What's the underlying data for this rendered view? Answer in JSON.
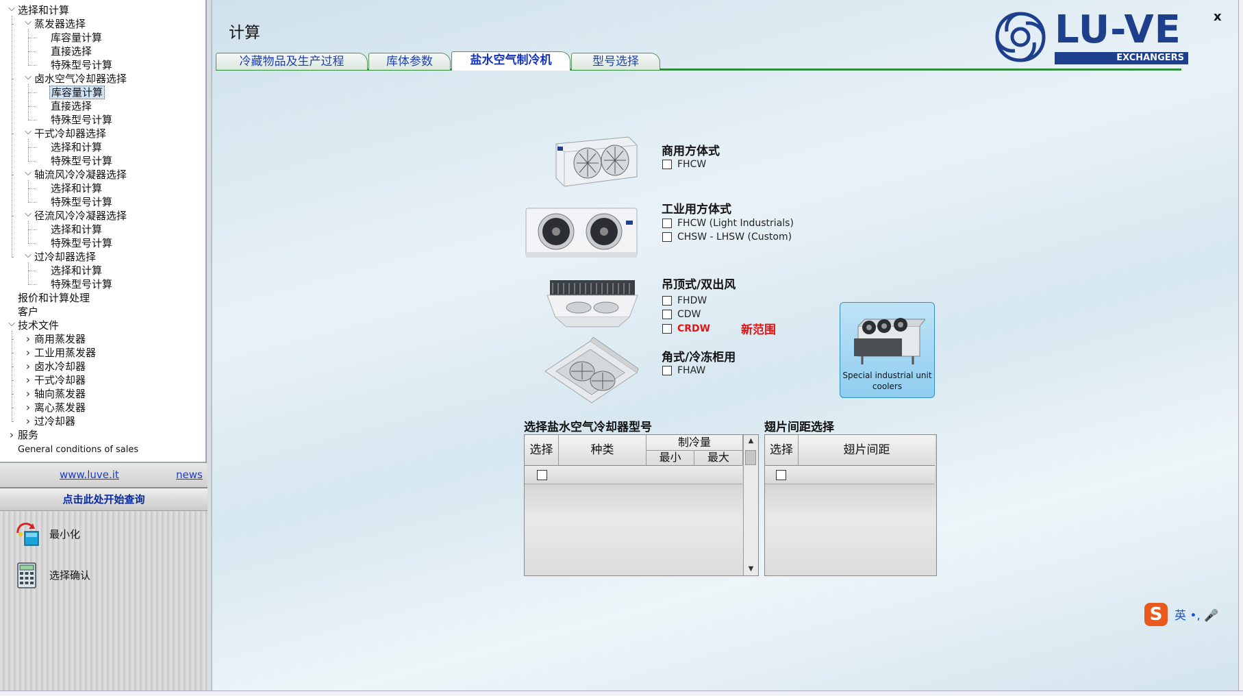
{
  "tree": {
    "items": [
      {
        "label": "选择和计算",
        "level": 0,
        "expander": "down"
      },
      {
        "label": "蒸发器选择",
        "level": 1,
        "expander": "down"
      },
      {
        "label": "库容量计算",
        "level": 2
      },
      {
        "label": "直接选择",
        "level": 2
      },
      {
        "label": "特殊型号计算",
        "level": 2
      },
      {
        "label": "卤水空气冷却器选择",
        "level": 1,
        "expander": "down"
      },
      {
        "label": "库容量计算",
        "level": 2,
        "selected": true
      },
      {
        "label": "直接选择",
        "level": 2
      },
      {
        "label": "特殊型号计算",
        "level": 2
      },
      {
        "label": "干式冷却器选择",
        "level": 1,
        "expander": "down"
      },
      {
        "label": "选择和计算",
        "level": 2
      },
      {
        "label": "特殊型号计算",
        "level": 2
      },
      {
        "label": "轴流风冷冷凝器选择",
        "level": 1,
        "expander": "down"
      },
      {
        "label": "选择和计算",
        "level": 2
      },
      {
        "label": "特殊型号计算",
        "level": 2
      },
      {
        "label": "径流风冷冷凝器选择",
        "level": 1,
        "expander": "down"
      },
      {
        "label": "选择和计算",
        "level": 2
      },
      {
        "label": "特殊型号计算",
        "level": 2
      },
      {
        "label": "过冷却器选择",
        "level": 1,
        "expander": "down"
      },
      {
        "label": "选择和计算",
        "level": 2
      },
      {
        "label": "特殊型号计算",
        "level": 2
      },
      {
        "label": "报价和计算处理",
        "level": 0
      },
      {
        "label": "客户",
        "level": 0
      },
      {
        "label": "技术文件",
        "level": 0,
        "expander": "down"
      },
      {
        "label": "商用蒸发器",
        "level": 1,
        "expander": "right"
      },
      {
        "label": "工业用蒸发器",
        "level": 1,
        "expander": "right"
      },
      {
        "label": "卤水冷却器",
        "level": 1,
        "expander": "right"
      },
      {
        "label": "干式冷却器",
        "level": 1,
        "expander": "right"
      },
      {
        "label": "轴向蒸发器",
        "level": 1,
        "expander": "right"
      },
      {
        "label": "离心蒸发器",
        "level": 1,
        "expander": "right"
      },
      {
        "label": "过冷却器",
        "level": 1,
        "expander": "right"
      },
      {
        "label": "服务",
        "level": 0,
        "expander": "right"
      },
      {
        "label": "General conditions of sales",
        "level": 0
      }
    ]
  },
  "links": {
    "site": "www.luve.it",
    "news": "news"
  },
  "start_query": "点击此处开始查询",
  "actions": {
    "minimize": "最小化",
    "confirm": "选择确认"
  },
  "main": {
    "title": "计算",
    "close": "x",
    "logo": {
      "word": "LU-VE",
      "band": "EXCHANGERS",
      "accent": "#1d3f8c"
    },
    "tabs": [
      "冷藏物品及生产过程",
      "库体参数",
      "盐水空气制冷机",
      "型号选择"
    ],
    "active_tab": 2
  },
  "groups": {
    "commercial": {
      "title": "商用方体式",
      "options": [
        "FHCW"
      ]
    },
    "industrial": {
      "title": "工业用方体式",
      "options": [
        "FHCW (Light Industrials)",
        "CHSW - LHSW (Custom)"
      ]
    },
    "ceiling": {
      "title": "吊顶式/双出风",
      "options": [
        "FHDW",
        "CDW",
        "CRDW"
      ],
      "new_range": "新范围"
    },
    "corner": {
      "title": "角式/冷冻柜用",
      "options": [
        "FHAW"
      ]
    }
  },
  "special": {
    "label": "Special industrial unit coolers"
  },
  "model_grid": {
    "title": "选择盐水空气冷却器型号",
    "headers": {
      "select": "选择",
      "type": "种类",
      "capacity": "制冷量",
      "min": "最小",
      "max": "最大"
    }
  },
  "fin_grid": {
    "title": "翅片间距选择",
    "headers": {
      "select": "选择",
      "pitch": "翅片间距"
    }
  },
  "ime": {
    "logo": "S",
    "text": "英 •, 🎤"
  },
  "colors": {
    "tab_line": "#2f8a3a",
    "new_range": "#e01515",
    "link": "#1a3ccc"
  }
}
